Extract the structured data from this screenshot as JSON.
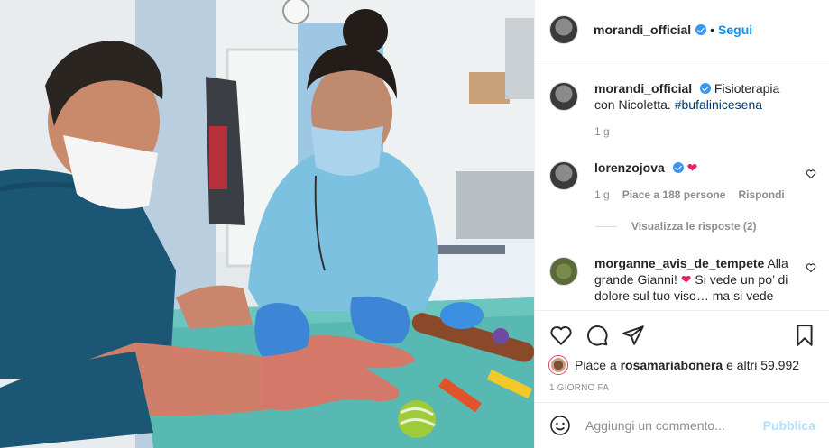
{
  "header": {
    "username": "morandi_official",
    "separator": "•",
    "follow_label": "Segui"
  },
  "caption": {
    "username": "morandi_official",
    "text": "Fisioterapia con Nicoletta.",
    "hashtag": "#bufalinicesena",
    "time": "1 g"
  },
  "comments": [
    {
      "username": "lorenzojova",
      "text": "",
      "emoji": "❤",
      "time": "1 g",
      "likes": "Piace a 188 persone",
      "reply_label": "Rispondi",
      "view_replies": "Visualizza le risposte (2)"
    },
    {
      "username": "morganne_avis_de_tempete",
      "text_before": "Alla grande Gianni!",
      "emoji": "❤",
      "text_after": "Si vede un po’ di dolore sul tuo viso… ma si vede"
    }
  ],
  "likes_line": {
    "prefix": "Piace a",
    "user": "rosamariabonera",
    "suffix": "e altri 59.992"
  },
  "date": "1 GIORNO FA",
  "composer": {
    "placeholder": "Aggiungi un commento...",
    "publish_label": "Pubblica"
  },
  "icons": {
    "like": "heart-outline-icon",
    "comment": "speech-bubble-icon",
    "share": "paper-plane-icon",
    "save": "bookmark-icon",
    "emoji": "smiley-icon"
  },
  "colors": {
    "accent": "#0095f6",
    "verified": "#3897f0",
    "secondary_text": "#8e8e8e",
    "publish_disabled": "#b2dffc"
  }
}
